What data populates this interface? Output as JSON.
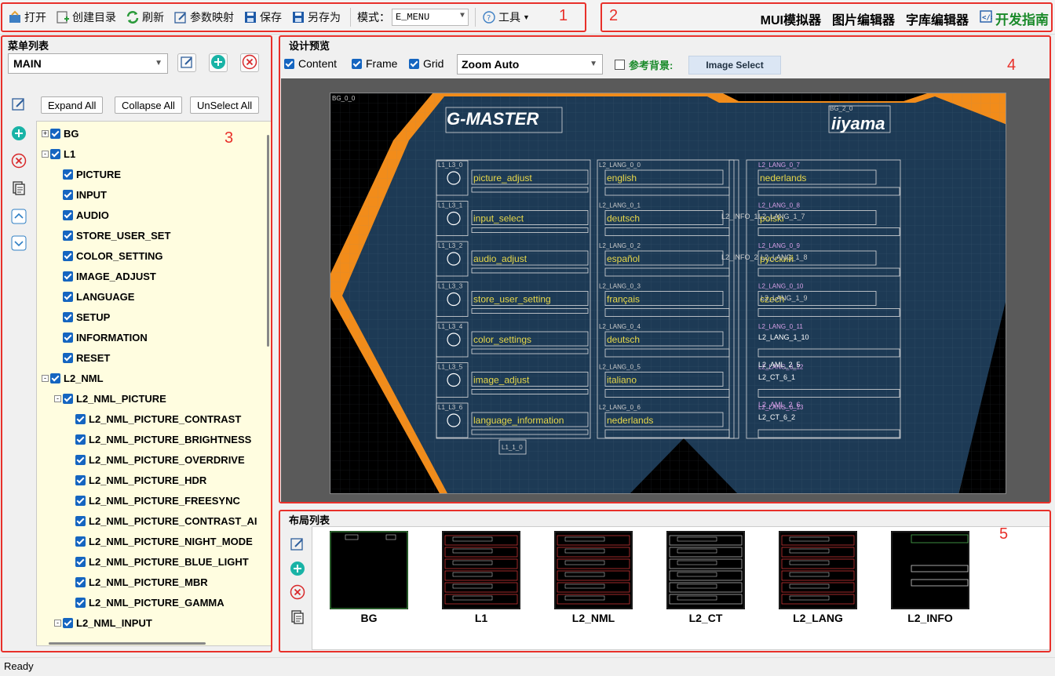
{
  "toolbar": {
    "open": "打开",
    "create_dir": "创建目录",
    "refresh": "刷新",
    "param_map": "参数映射",
    "save": "保存",
    "save_as": "另存为",
    "mode_label": "模式：",
    "mode_value": "E_MENU",
    "tools": "工具"
  },
  "right_tools": {
    "mui": "MUI模拟器",
    "image_editor": "图片编辑器",
    "font_editor": "字库编辑器",
    "dev_guide": "开发指南"
  },
  "menu_list": {
    "title": "菜单列表",
    "selected": "MAIN",
    "expand_all": "Expand All",
    "collapse_all": "Collapse All",
    "unselect_all": "UnSelect All",
    "tree": [
      {
        "label": "BG",
        "depth": 0,
        "expander": "+"
      },
      {
        "label": "L1",
        "depth": 0,
        "expander": "-"
      },
      {
        "label": "PICTURE",
        "depth": 1,
        "expander": ""
      },
      {
        "label": "INPUT",
        "depth": 1,
        "expander": ""
      },
      {
        "label": "AUDIO",
        "depth": 1,
        "expander": ""
      },
      {
        "label": "STORE_USER_SET",
        "depth": 1,
        "expander": ""
      },
      {
        "label": "COLOR_SETTING",
        "depth": 1,
        "expander": ""
      },
      {
        "label": "IMAGE_ADJUST",
        "depth": 1,
        "expander": ""
      },
      {
        "label": "LANGUAGE",
        "depth": 1,
        "expander": ""
      },
      {
        "label": "SETUP",
        "depth": 1,
        "expander": ""
      },
      {
        "label": "INFORMATION",
        "depth": 1,
        "expander": ""
      },
      {
        "label": "RESET",
        "depth": 1,
        "expander": ""
      },
      {
        "label": "L2_NML",
        "depth": 0,
        "expander": "-"
      },
      {
        "label": "L2_NML_PICTURE",
        "depth": 1,
        "expander": "-"
      },
      {
        "label": "L2_NML_PICTURE_CONTRAST",
        "depth": 2,
        "expander": ""
      },
      {
        "label": "L2_NML_PICTURE_BRIGHTNESS",
        "depth": 2,
        "expander": ""
      },
      {
        "label": "L2_NML_PICTURE_OVERDRIVE",
        "depth": 2,
        "expander": ""
      },
      {
        "label": "L2_NML_PICTURE_HDR",
        "depth": 2,
        "expander": ""
      },
      {
        "label": "L2_NML_PICTURE_FREESYNC",
        "depth": 2,
        "expander": ""
      },
      {
        "label": "L2_NML_PICTURE_CONTRAST_AI",
        "depth": 2,
        "expander": ""
      },
      {
        "label": "L2_NML_PICTURE_NIGHT_MODE",
        "depth": 2,
        "expander": ""
      },
      {
        "label": "L2_NML_PICTURE_BLUE_LIGHT",
        "depth": 2,
        "expander": ""
      },
      {
        "label": "L2_NML_PICTURE_MBR",
        "depth": 2,
        "expander": ""
      },
      {
        "label": "L2_NML_PICTURE_GAMMA",
        "depth": 2,
        "expander": ""
      },
      {
        "label": "L2_NML_INPUT",
        "depth": 1,
        "expander": "-"
      }
    ]
  },
  "preview": {
    "title": "设计预览",
    "content": "Content",
    "frame": "Frame",
    "grid": "Grid",
    "zoom": "Zoom Auto",
    "ref_bg": "参考背景:",
    "image_select": "Image Select",
    "logo_left": "G-MASTER",
    "logo_right": "iiyama",
    "bg_tag": "BG_0_0",
    "bg2_tag": "BG_2_0",
    "l1_items": [
      "picture_adjust",
      "input_select",
      "audio_adjust",
      "store_user_setting",
      "color_settings",
      "image_adjust",
      "language_information"
    ],
    "l1_tags": [
      "L1_L3_0",
      "L1_L3_1",
      "L1_L3_2",
      "L1_L3_3",
      "L1_L3_4",
      "L1_L3_5",
      "L1_L3_6"
    ],
    "mid_items": [
      "english",
      "deutsch",
      "español",
      "français",
      "deutsch",
      "italiano",
      "nederlands"
    ],
    "right_items": [
      "nederlands",
      "polski",
      "русский",
      "czech",
      "",
      "",
      ""
    ],
    "extra_tags": [
      "L2_INFO_1",
      "L2_LANG_1_7",
      "L2_INFO_2",
      "L2_LANG_1_8",
      "L2_LANG_1_9",
      "L2_LANG_1_10",
      "L2_AML_2_5",
      "L2_CT_6_1",
      "L2_AML_2_6",
      "L2_CT_6_2",
      "L1_1_0"
    ]
  },
  "layout_list": {
    "title": "布局列表",
    "items": [
      "BG",
      "L1",
      "L2_NML",
      "L2_CT",
      "L2_LANG",
      "L2_INFO"
    ]
  },
  "markers": [
    "1",
    "2",
    "3",
    "4",
    "5"
  ],
  "status": "Ready",
  "colors": {
    "accent_orange": "#f28c1a",
    "panel_blue": "#1d3a55",
    "guide_green": "#1a8a2a",
    "marker_red": "#e8302a",
    "tree_bg": "#fffde0",
    "checkbox_blue": "#1565c0"
  }
}
